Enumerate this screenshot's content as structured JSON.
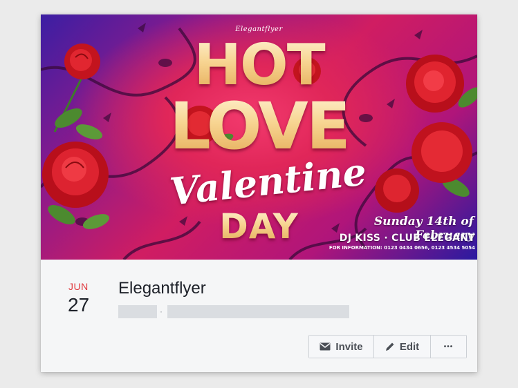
{
  "cover": {
    "brand": "Elegantflyer",
    "headline_top": "HOT",
    "headline_bottom": "LOVE",
    "script_word": "Valentine",
    "day_word": "DAY",
    "date_line": "Sunday 14th of February",
    "dj_line": "DJ KISS · CLUB ELEGANT",
    "info_line": "FOR INFORMATION: 0123 0434 0656, 0123 4534 5054"
  },
  "event": {
    "month": "JUN",
    "day": "27",
    "title": "Elegantflyer",
    "separator": "·"
  },
  "actions": {
    "invite_label": "Invite",
    "invite_icon": "envelope-icon",
    "edit_label": "Edit",
    "edit_icon": "pencil-icon",
    "more_label": "•••",
    "more_icon": "more-icon"
  },
  "colors": {
    "month_red": "#e0393e",
    "text_dark": "#1d2129",
    "button_text": "#4b4f56",
    "gold": "#f7d491"
  }
}
